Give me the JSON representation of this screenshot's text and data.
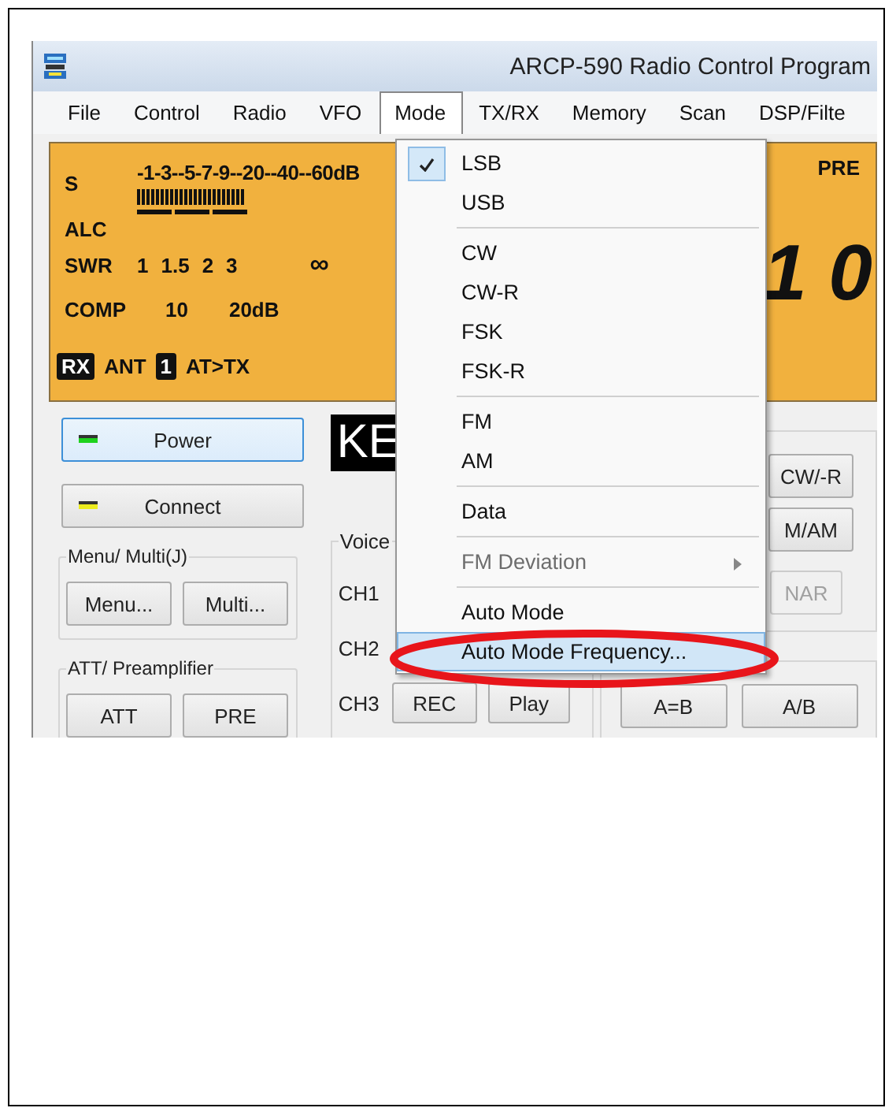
{
  "window": {
    "title": "ARCP-590 Radio Control Program"
  },
  "menu_bar": [
    {
      "label": "File",
      "selected": false
    },
    {
      "label": "Control",
      "selected": false
    },
    {
      "label": "Radio",
      "selected": false
    },
    {
      "label": "VFO",
      "selected": false
    },
    {
      "label": "Mode",
      "selected": true
    },
    {
      "label": "TX/RX",
      "selected": false
    },
    {
      "label": "Memory",
      "selected": false
    },
    {
      "label": "Scan",
      "selected": false
    },
    {
      "label": "DSP/Filte",
      "selected": false
    }
  ],
  "meter_panel": {
    "s_label": "S",
    "s_scale": "-1-3--5-7-9--20--40--60dB",
    "alc_label": "ALC",
    "swr_label": "SWR",
    "swr_scale": [
      "1",
      "1.5",
      "2",
      "3"
    ],
    "swr_infinity": "∞",
    "comp_label": "COMP",
    "comp_scale": [
      "10",
      "20dB"
    ],
    "rx_badge": "RX",
    "ant_label": "ANT",
    "ant_number": "1",
    "at_label": "AT>TX",
    "pre_label": "PRE",
    "frequency_digits": "1 0"
  },
  "main_buttons": [
    {
      "label": "Power",
      "color": "#1ed21e",
      "selected": true
    },
    {
      "label": "Connect",
      "color": "#ecec1e",
      "selected": false
    }
  ],
  "menu_multi": {
    "title": "Menu/ Multi(J)",
    "buttons": [
      "Menu...",
      "Multi..."
    ]
  },
  "att_preamp": {
    "title": "ATT/ Preamplifier",
    "buttons": [
      "ATT",
      "PRE"
    ]
  },
  "display_label": "KE",
  "voice": {
    "title": "Voice",
    "channels": [
      "CH1",
      "CH2",
      "CH3"
    ],
    "buttons": [
      "REC",
      "Play"
    ]
  },
  "mode_buttons": [
    {
      "label": "CW/-R",
      "disabled": false
    },
    {
      "label": "M/AM",
      "disabled": false
    },
    {
      "label": "NAR",
      "disabled": true
    }
  ],
  "vfo_buttons": [
    "A=B",
    "A/B"
  ],
  "mode_menu": {
    "items": [
      {
        "kind": "item",
        "label": "LSB",
        "checked": true,
        "disabled": false,
        "submenu": false,
        "selected": false
      },
      {
        "kind": "item",
        "label": "USB",
        "checked": false,
        "disabled": false,
        "submenu": false,
        "selected": false
      },
      {
        "kind": "separator"
      },
      {
        "kind": "item",
        "label": "CW",
        "checked": false,
        "disabled": false,
        "submenu": false,
        "selected": false
      },
      {
        "kind": "item",
        "label": "CW-R",
        "checked": false,
        "disabled": false,
        "submenu": false,
        "selected": false
      },
      {
        "kind": "item",
        "label": "FSK",
        "checked": false,
        "disabled": false,
        "submenu": false,
        "selected": false
      },
      {
        "kind": "item",
        "label": "FSK-R",
        "checked": false,
        "disabled": false,
        "submenu": false,
        "selected": false
      },
      {
        "kind": "separator"
      },
      {
        "kind": "item",
        "label": "FM",
        "checked": false,
        "disabled": false,
        "submenu": false,
        "selected": false
      },
      {
        "kind": "item",
        "label": "AM",
        "checked": false,
        "disabled": false,
        "submenu": false,
        "selected": false
      },
      {
        "kind": "separator"
      },
      {
        "kind": "item",
        "label": "Data",
        "checked": false,
        "disabled": false,
        "submenu": false,
        "selected": false
      },
      {
        "kind": "separator"
      },
      {
        "kind": "item",
        "label": "FM Deviation",
        "checked": false,
        "disabled": true,
        "submenu": true,
        "selected": false
      },
      {
        "kind": "separator"
      },
      {
        "kind": "item",
        "label": "Auto Mode",
        "checked": false,
        "disabled": false,
        "submenu": false,
        "selected": false
      },
      {
        "kind": "item",
        "label": "Auto Mode Frequency...",
        "checked": false,
        "disabled": false,
        "submenu": false,
        "selected": true
      }
    ]
  }
}
